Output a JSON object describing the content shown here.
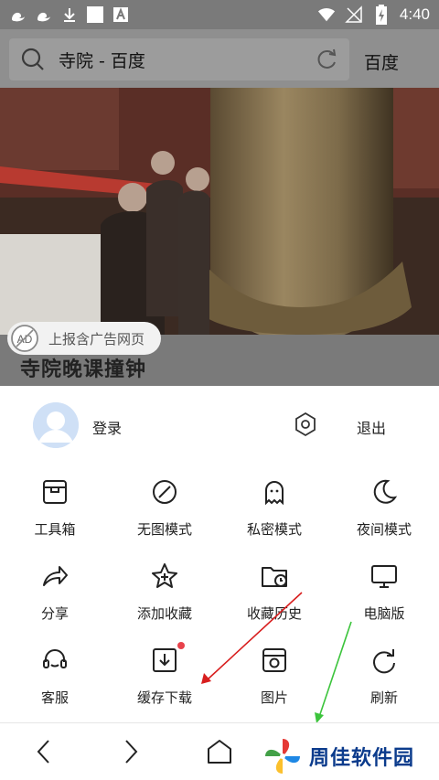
{
  "status_bar": {
    "time": "4:40",
    "icons": [
      "uc-browser-icon",
      "uc-browser-icon",
      "download-icon",
      "square-app-icon",
      "a-app-icon",
      "wifi-icon",
      "no-signal-icon",
      "battery-icon"
    ]
  },
  "top_bar": {
    "search_text": "寺院 - 百度",
    "action_label": "百度"
  },
  "article": {
    "title": "寺院晚课撞钟",
    "ad_report_label": "上报含广告网页",
    "ad_icon_text": "AD"
  },
  "menu": {
    "login_label": "登录",
    "logout_label": "退出",
    "items": [
      {
        "label": "工具箱",
        "icon": "toolbox-icon"
      },
      {
        "label": "无图模式",
        "icon": "no-image-icon"
      },
      {
        "label": "私密模式",
        "icon": "ghost-icon"
      },
      {
        "label": "夜间模式",
        "icon": "moon-icon"
      },
      {
        "label": "分享",
        "icon": "share-icon"
      },
      {
        "label": "添加收藏",
        "icon": "star-add-icon"
      },
      {
        "label": "收藏历史",
        "icon": "folder-history-icon"
      },
      {
        "label": "电脑版",
        "icon": "desktop-icon"
      },
      {
        "label": "客服",
        "icon": "headset-icon"
      },
      {
        "label": "缓存下载",
        "icon": "download-box-icon"
      },
      {
        "label": "图片",
        "icon": "picture-icon"
      },
      {
        "label": "刷新",
        "icon": "refresh-icon"
      }
    ]
  },
  "watermark": {
    "text": "周佳软件园"
  },
  "colors": {
    "accent_red": "#e8424b",
    "annotation_red": "#d81e1e",
    "annotation_green": "#3cc43c",
    "watermark_blue": "#0b3b8c"
  }
}
